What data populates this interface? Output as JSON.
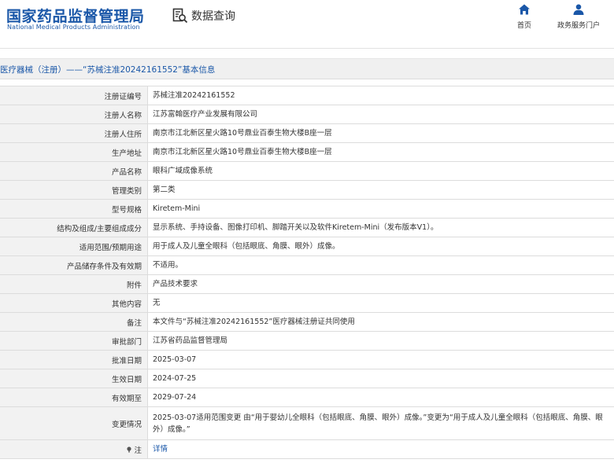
{
  "header": {
    "logo_cn": "国家药品监督管理局",
    "logo_en": "National Medical Products Administration",
    "query_label": "数据查询",
    "nav": [
      {
        "label": "首页",
        "icon": "home-icon"
      },
      {
        "label": "政务服务门户",
        "icon": "user-icon"
      }
    ]
  },
  "title": "医疗器械（注册）——“苏械注准20242161552”基本信息",
  "colors": {
    "brand": "#1a57a8",
    "label_bg": "#f2f2f2",
    "border": "#dcdcdc"
  },
  "rows": [
    {
      "label": "注册证编号",
      "value": "苏械注准20242161552"
    },
    {
      "label": "注册人名称",
      "value": "江苏富翰医疗产业发展有限公司"
    },
    {
      "label": "注册人住所",
      "value": "南京市江北新区星火路10号鼎业百泰生物大楼B座一层"
    },
    {
      "label": "生产地址",
      "value": "南京市江北新区星火路10号鼎业百泰生物大楼B座一层"
    },
    {
      "label": "产品名称",
      "value": "眼科广域成像系统"
    },
    {
      "label": "管理类别",
      "value": "第二类"
    },
    {
      "label": "型号规格",
      "value": "Kiretem-Mini"
    },
    {
      "label": "结构及组成/主要组成成分",
      "value": "显示系统、手持设备、图像打印机、脚踏开关以及软件Kiretem-Mini（发布版本V1）。"
    },
    {
      "label": "适用范围/预期用途",
      "value": "用于成人及儿童全眼科（包括眼底、角膜、眼外）成像。"
    },
    {
      "label": "产品储存条件及有效期",
      "value": "不适用。"
    },
    {
      "label": "附件",
      "value": "产品技术要求"
    },
    {
      "label": "其他内容",
      "value": "无"
    },
    {
      "label": "备注",
      "value": "本文件与“苏械注准20242161552”医疗器械注册证共同使用"
    },
    {
      "label": "审批部门",
      "value": "江苏省药品监督管理局"
    },
    {
      "label": "批准日期",
      "value": "2025-03-07"
    },
    {
      "label": "生效日期",
      "value": "2024-07-25"
    },
    {
      "label": "有效期至",
      "value": "2029-07-24"
    },
    {
      "label": "变更情况",
      "value": "2025-03-07适用范围变更 由“用于婴幼儿全眼科（包括眼底、角膜、眼外）成像。”变更为“用于成人及儿童全眼科（包括眼底、角膜、眼外）成像。”"
    },
    {
      "label": "注",
      "value": "详情",
      "icon": "note-icon"
    }
  ]
}
